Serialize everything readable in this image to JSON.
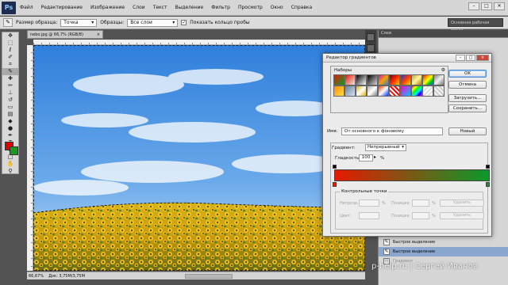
{
  "app": {
    "logo": "Ps"
  },
  "menu": [
    "Файл",
    "Редактирование",
    "Изображение",
    "Слои",
    "Текст",
    "Выделение",
    "Фильтр",
    "Просмотр",
    "Окно",
    "Справка"
  ],
  "options_bar": {
    "sample_size_label": "Размер образца:",
    "sample_size_value": "Точка",
    "sample_label": "Образцы:",
    "sample_value": "Все слои",
    "show_ring_label": "Показать кольцо пробы",
    "workspace": "Основная рабочая среда"
  },
  "document": {
    "tab_title": "nebo.jpg @ 66,7% (RGB/8)",
    "zoom": "66,67%",
    "doc_size": "Док: 3,75M/3,75M"
  },
  "panels": {
    "header": "Слои",
    "history": [
      "Быстрое выделение",
      "Быстрое выделение",
      "Градиент"
    ]
  },
  "watermark": "p-help.ru | Сергей Иванов",
  "gradient_editor": {
    "title": "Редактор градиентов",
    "presets_label": "Наборы",
    "buttons": {
      "ok": "OK",
      "cancel": "Отмена",
      "load": "Загрузить...",
      "save": "Сохранить...",
      "new": "Новый"
    },
    "name_label": "Имя:",
    "name_value": "От основного к фоновому",
    "type_label": "Градиент:",
    "type_value": "Непрерывный",
    "smoothness_label": "Гладкость:",
    "smoothness_value": "100",
    "smoothness_unit": "%",
    "control_points_label": "Контрольные точки",
    "opacity_label": "Непрозр.:",
    "location_label": "Позиция:",
    "delete_label": "Удалить",
    "color_label": "Цвет:",
    "percent": "%",
    "start_color": "#e61a00",
    "end_color": "#0a9a2a"
  },
  "colors": {
    "foreground": "#e00000",
    "background": "#1a9a1a"
  }
}
